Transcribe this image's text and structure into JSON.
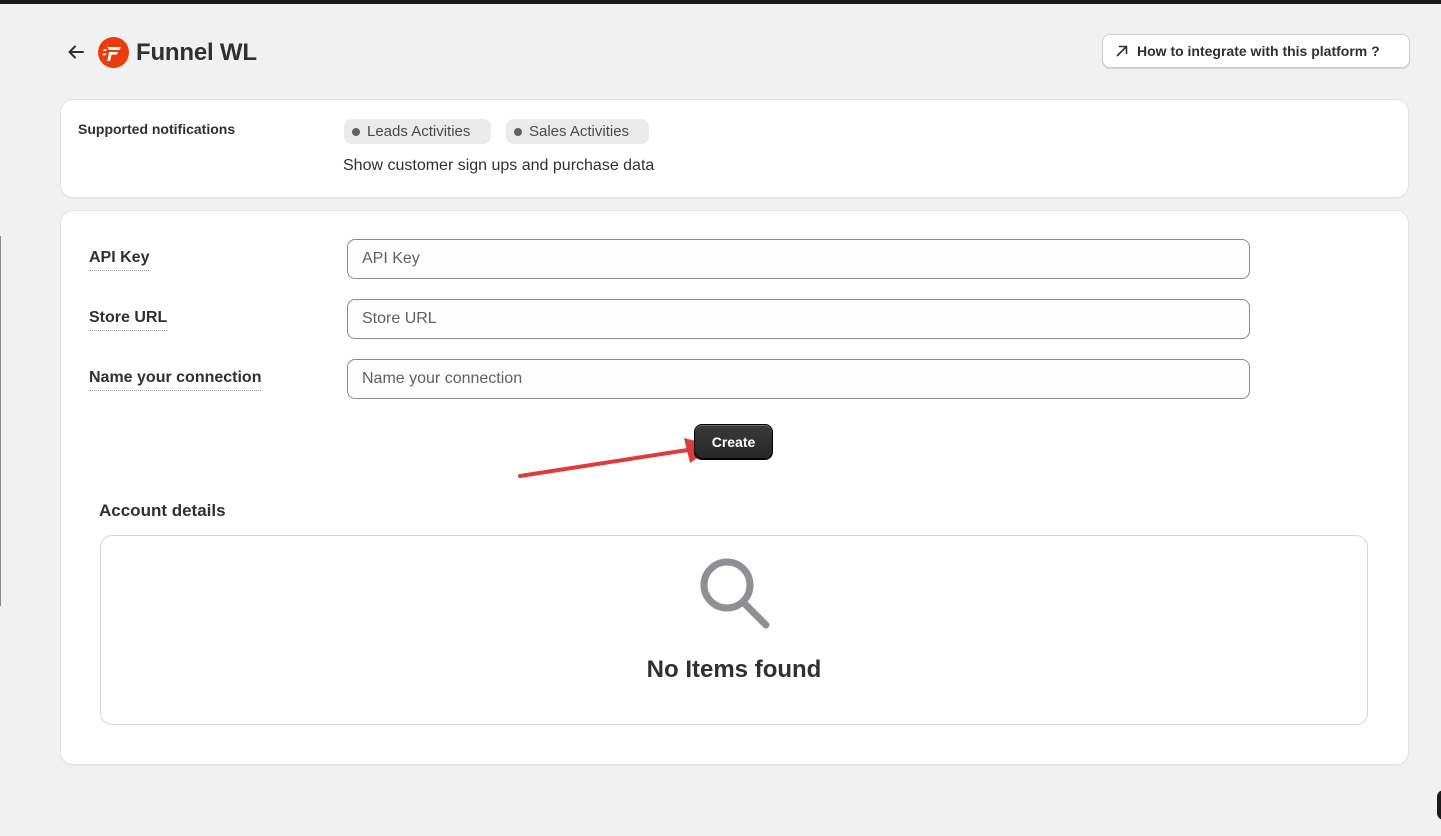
{
  "header": {
    "title": "Funnel WL",
    "back_icon": "arrow-left-icon",
    "logo_icon": "funnel-logo",
    "help_label": "How to integrate with this platform ?",
    "help_icon": "arrow-up-right-icon"
  },
  "notifications": {
    "label": "Supported notifications",
    "tags": [
      "Leads Activities",
      "Sales Activities"
    ],
    "description": "Show customer sign ups and purchase data"
  },
  "form": {
    "fields": [
      {
        "label": "API Key",
        "placeholder": "API Key",
        "value": ""
      },
      {
        "label": "Store URL",
        "placeholder": "Store URL",
        "value": ""
      },
      {
        "label": "Name your connection",
        "placeholder": "Name your connection",
        "value": ""
      }
    ],
    "create_label": "Create"
  },
  "account": {
    "title": "Account details",
    "empty_text": "No Items found",
    "empty_icon": "search-icon"
  },
  "colors": {
    "brand": "#e8400c",
    "primary_button": "#303030",
    "annotation_arrow": "#e03a3a",
    "background": "#f1f1f1"
  }
}
